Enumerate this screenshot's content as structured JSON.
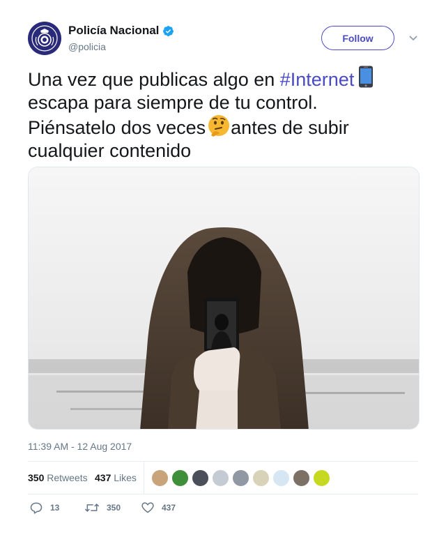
{
  "account": {
    "display_name": "Policía Nacional",
    "handle": "@policia",
    "verified": true
  },
  "header": {
    "follow_label": "Follow"
  },
  "tweet": {
    "text_before_hashtag": "Una vez que publicas algo en ",
    "hashtag": "#Internet",
    "text_line2": "escapa para siempre de tu control.",
    "text_line3a": "Piénsatelo dos veces",
    "text_line3b": "antes de subir",
    "text_line4": "cualquier contenido",
    "timestamp": "11:39 AM - 12 Aug 2017"
  },
  "stats": {
    "retweets_count": "350",
    "retweets_label": "Retweets",
    "likes_count": "437",
    "likes_label": "Likes"
  },
  "actions": {
    "reply_count": "13",
    "retweet_count": "350",
    "like_count": "437"
  },
  "colors": {
    "accent": "#4a4bc4",
    "verified": "#1da1f2",
    "muted": "#657786"
  },
  "icons": [
    "verified-badge-icon",
    "chevron-down-icon",
    "phone-emoji-icon",
    "thinking-face-emoji-icon",
    "reply-icon",
    "retweet-icon",
    "heart-icon"
  ]
}
